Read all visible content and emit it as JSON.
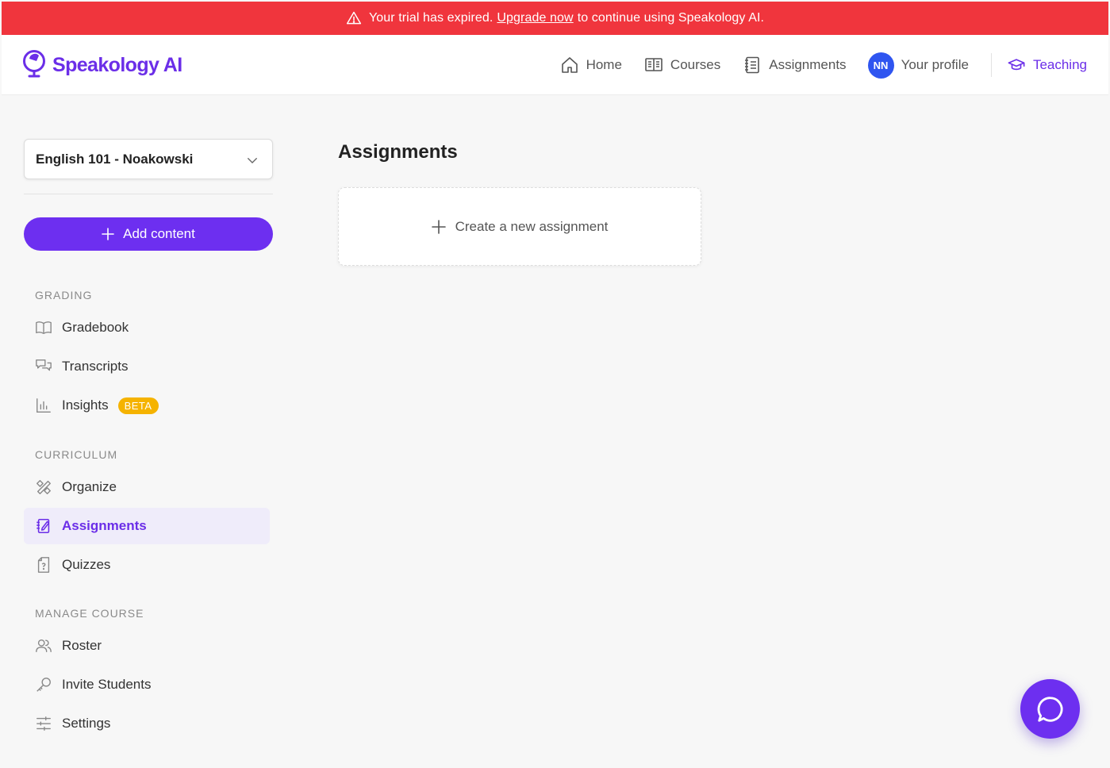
{
  "banner": {
    "text_before": "Your trial has expired.",
    "link": "Upgrade now",
    "text_after": "to continue using Speakology AI.",
    "bg_color": "#f0353d"
  },
  "header": {
    "logo_text": "Speakology AI",
    "nav": {
      "home": "Home",
      "courses": "Courses",
      "assignments": "Assignments",
      "avatar_initials": "NN",
      "profile": "Your profile",
      "teaching": "Teaching"
    }
  },
  "sidebar": {
    "course": "English 101 - Noakowski",
    "add_content": "Add content",
    "sections": {
      "grading": {
        "label": "GRADING",
        "items": [
          {
            "label": "Gradebook",
            "icon": "book-open-icon"
          },
          {
            "label": "Transcripts",
            "icon": "chat-bubbles-icon"
          },
          {
            "label": "Insights",
            "icon": "bar-chart-icon",
            "badge": "BETA"
          }
        ]
      },
      "curriculum": {
        "label": "CURRICULUM",
        "items": [
          {
            "label": "Organize",
            "icon": "tools-icon"
          },
          {
            "label": "Assignments",
            "icon": "edit-list-icon",
            "active": true
          },
          {
            "label": "Quizzes",
            "icon": "quiz-icon"
          }
        ]
      },
      "manage": {
        "label": "MANAGE COURSE",
        "items": [
          {
            "label": "Roster",
            "icon": "users-icon"
          },
          {
            "label": "Invite Students",
            "icon": "key-icon"
          },
          {
            "label": "Settings",
            "icon": "sliders-icon"
          }
        ]
      }
    }
  },
  "main": {
    "title": "Assignments",
    "create_label": "Create a new assignment"
  },
  "colors": {
    "accent": "#6d2ff0",
    "avatar": "#2f55f0",
    "badge": "#f5b300"
  }
}
